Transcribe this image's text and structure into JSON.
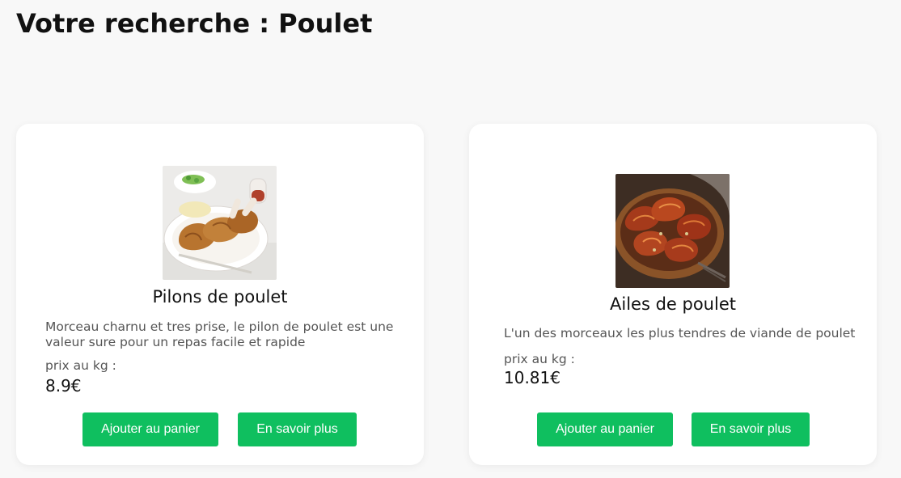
{
  "page": {
    "title": "Votre recherche : Poulet"
  },
  "products": [
    {
      "name": "Pilons de poulet",
      "description": "Morceau charnu et tres prise, le pilon de poulet est une valeur sure pour un repas facile et rapide",
      "price_label": "prix au kg :",
      "price": "8.9€",
      "add_to_cart_label": "Ajouter au panier",
      "more_label": "En savoir plus"
    },
    {
      "name": "Ailes de poulet",
      "description": "L'un des morceaux les plus tendres de viande de poulet",
      "price_label": "prix au kg :",
      "price": "10.81€",
      "add_to_cart_label": "Ajouter au panier",
      "more_label": "En savoir plus"
    }
  ],
  "colors": {
    "button": "#0fbf5f",
    "card": "#ffffff",
    "background": "#f8f8f8"
  }
}
